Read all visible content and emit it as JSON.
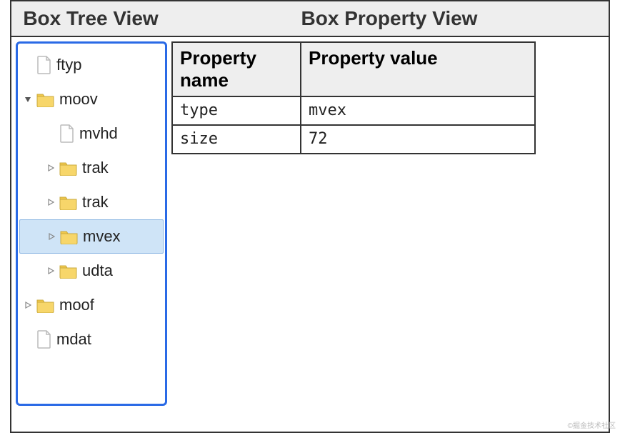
{
  "header": {
    "tree_title": "Box Tree View",
    "prop_title": "Box Property View"
  },
  "tree": {
    "selected": "mvex",
    "nodes": [
      {
        "id": "ftyp",
        "label": "ftyp",
        "type": "file",
        "depth": 0,
        "expander": "none"
      },
      {
        "id": "moov",
        "label": "moov",
        "type": "folder",
        "depth": 0,
        "expander": "open"
      },
      {
        "id": "mvhd",
        "label": "mvhd",
        "type": "file",
        "depth": 1,
        "expander": "none"
      },
      {
        "id": "trak1",
        "label": "trak",
        "type": "folder",
        "depth": 1,
        "expander": "closed"
      },
      {
        "id": "trak2",
        "label": "trak",
        "type": "folder",
        "depth": 1,
        "expander": "closed"
      },
      {
        "id": "mvex",
        "label": "mvex",
        "type": "folder",
        "depth": 1,
        "expander": "closed"
      },
      {
        "id": "udta",
        "label": "udta",
        "type": "folder",
        "depth": 1,
        "expander": "closed"
      },
      {
        "id": "moof",
        "label": "moof",
        "type": "folder",
        "depth": 0,
        "expander": "closed"
      },
      {
        "id": "mdat",
        "label": "mdat",
        "type": "file",
        "depth": 0,
        "expander": "none"
      }
    ]
  },
  "property_table": {
    "col_name": "Property name",
    "col_value": "Property value",
    "rows": [
      {
        "name": "type",
        "value": "mvex"
      },
      {
        "name": "size",
        "value": "72"
      }
    ]
  },
  "watermark": "©掘金技术社区"
}
